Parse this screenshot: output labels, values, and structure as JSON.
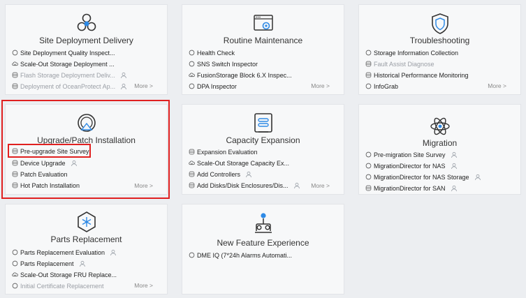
{
  "cards": {
    "site_deployment": {
      "title": "Site Deployment Delivery",
      "items": [
        {
          "label": "Site Deployment Quality Inspect...",
          "icon": "circle-icon"
        },
        {
          "label": "Scale-Out Storage Deployment ...",
          "icon": "cloud-icon"
        },
        {
          "label": "Flash Storage Deployment Deliv...",
          "icon": "disk-icon"
        },
        {
          "label": "Deployment of OceanProtect Ap...",
          "icon": "disk-icon"
        }
      ],
      "more": "More >"
    },
    "routine_maintenance": {
      "title": "Routine Maintenance",
      "items": [
        {
          "label": "Health Check",
          "icon": "circle-icon"
        },
        {
          "label": "SNS Switch Inspector",
          "icon": "circle-icon"
        },
        {
          "label": "FusionStorage Block 6.X Inspec...",
          "icon": "cloud-icon"
        },
        {
          "label": "DPA Inspector",
          "icon": "circle-icon"
        }
      ],
      "more": "More >"
    },
    "troubleshooting": {
      "title": "Troubleshooting",
      "items": [
        {
          "label": "Storage Information Collection",
          "icon": "circle-icon"
        },
        {
          "label": "Fault Assist Diagnose",
          "icon": "disk-icon"
        },
        {
          "label": "Historical Performance Monitoring",
          "icon": "disk-icon"
        },
        {
          "label": "InfoGrab",
          "icon": "circle-icon"
        }
      ],
      "more": "More >"
    },
    "upgrade_patch": {
      "title": "Upgrade/Patch Installation",
      "items": [
        {
          "label": "Pre-upgrade Site Survey",
          "icon": "disk-icon"
        },
        {
          "label": "Device Upgrade",
          "icon": "disk-icon"
        },
        {
          "label": "Patch Evaluation",
          "icon": "disk-icon"
        },
        {
          "label": "Hot Patch Installation",
          "icon": "disk-icon"
        }
      ],
      "more": "More >"
    },
    "capacity_expansion": {
      "title": "Capacity Expansion",
      "items": [
        {
          "label": "Expansion Evaluation",
          "icon": "disk-icon"
        },
        {
          "label": "Scale-Out Storage Capacity Ex...",
          "icon": "cloud-icon"
        },
        {
          "label": "Add Controllers",
          "icon": "disk-icon"
        },
        {
          "label": "Add Disks/Disk Enclosures/Dis...",
          "icon": "disk-icon"
        }
      ],
      "more": "More >"
    },
    "migration": {
      "title": "Migration",
      "items": [
        {
          "label": "Pre-migration Site Survey",
          "icon": "circle-icon"
        },
        {
          "label": "MigrationDirector for NAS",
          "icon": "circle-icon"
        },
        {
          "label": "MigrationDirector for NAS Storage",
          "icon": "circle-icon"
        },
        {
          "label": "MigrationDirector for SAN",
          "icon": "disk-icon"
        }
      ]
    },
    "parts_replacement": {
      "title": "Parts Replacement",
      "items": [
        {
          "label": "Parts Replacement Evaluation",
          "icon": "circle-icon"
        },
        {
          "label": "Parts Replacement",
          "icon": "circle-icon"
        },
        {
          "label": "Scale-Out Storage FRU Replace...",
          "icon": "cloud-icon"
        },
        {
          "label": "Initial Certificate Replacement",
          "icon": "circle-icon"
        }
      ],
      "more": "More >"
    },
    "new_feature": {
      "title": "New Feature Experience",
      "items": [
        {
          "label": "DME IQ (7*24h Alarms Automati...",
          "icon": "circle-icon"
        }
      ]
    }
  }
}
